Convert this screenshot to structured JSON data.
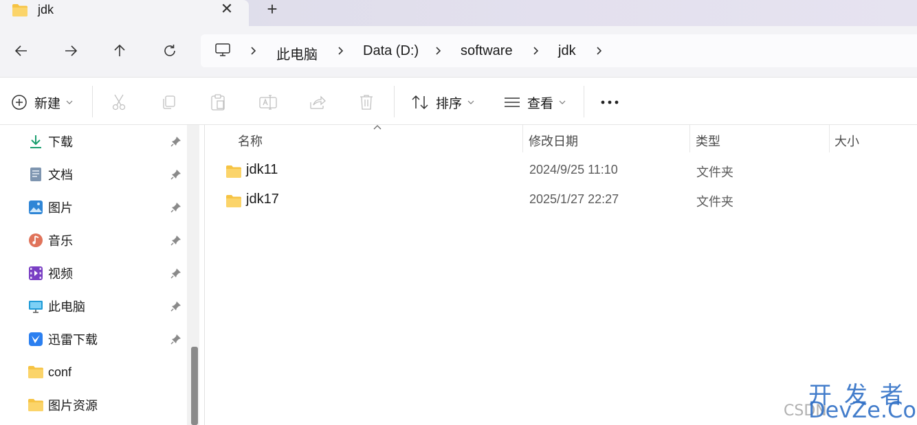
{
  "tab": {
    "title": "jdk",
    "close_label": "✕",
    "new_label": "+"
  },
  "nav": {
    "back_icon": "arrow-left-icon",
    "forward_icon": "arrow-right-icon",
    "up_icon": "arrow-up-icon",
    "refresh_icon": "refresh-icon",
    "breadcrumbs": [
      "此电脑",
      "Data (D:)",
      "software",
      "jdk"
    ]
  },
  "toolbar": {
    "new_label": "新建",
    "sort_label": "排序",
    "view_label": "查看",
    "more_label": "•••"
  },
  "sidebar": {
    "items": [
      {
        "label": "下载",
        "icon": "download-icon",
        "pinned": true
      },
      {
        "label": "文档",
        "icon": "document-icon",
        "pinned": true
      },
      {
        "label": "图片",
        "icon": "picture-icon",
        "pinned": true
      },
      {
        "label": "音乐",
        "icon": "music-icon",
        "pinned": true
      },
      {
        "label": "视频",
        "icon": "video-icon",
        "pinned": true
      },
      {
        "label": "此电脑",
        "icon": "computer-icon",
        "pinned": true
      },
      {
        "label": "迅雷下载",
        "icon": "xunlei-icon",
        "pinned": true
      },
      {
        "label": "conf",
        "icon": "folder-icon",
        "pinned": false
      },
      {
        "label": "图片资源",
        "icon": "folder-icon",
        "pinned": false
      }
    ]
  },
  "columns": {
    "name": "名称",
    "modified": "修改日期",
    "type": "类型",
    "size": "大小"
  },
  "files": [
    {
      "name": "jdk11",
      "modified": "2024/9/25 11:10",
      "type": "文件夹"
    },
    {
      "name": "jdk17",
      "modified": "2025/1/27 22:27",
      "type": "文件夹"
    }
  ],
  "watermark": {
    "cn": "开发者",
    "en": "DevZe.CoM",
    "csdn": "CSDN"
  },
  "colors": {
    "accent": "#2f6fc6",
    "folder": "#f6c343"
  }
}
